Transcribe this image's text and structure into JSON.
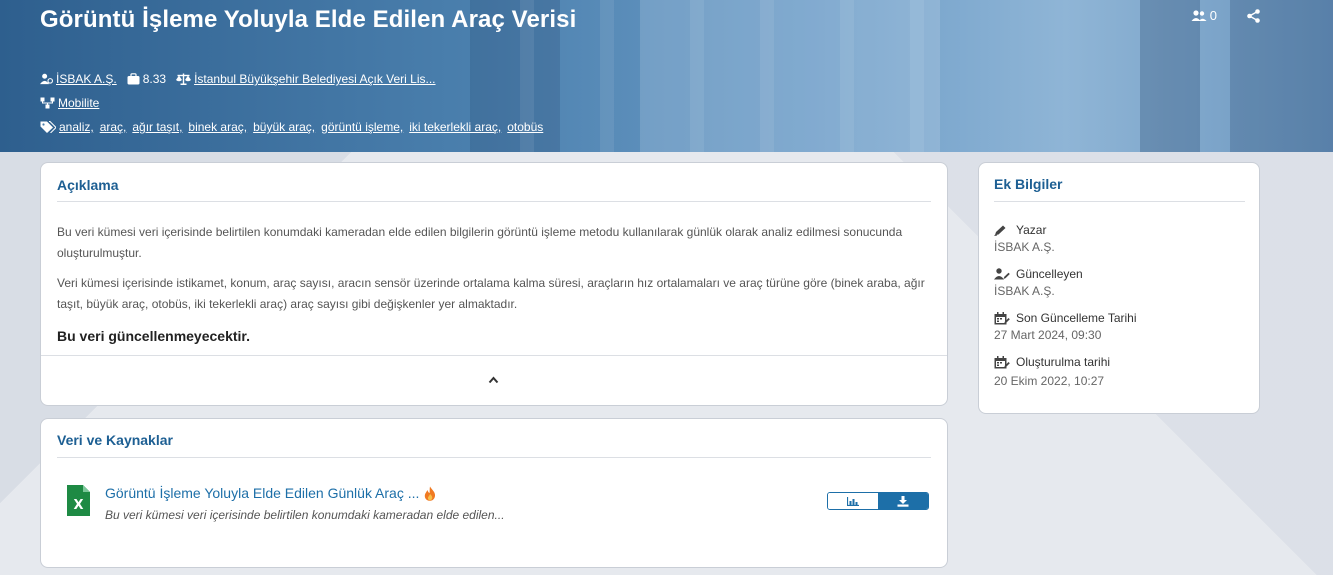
{
  "hero": {
    "title": "Görüntü İşleme Yoluyla Elde Edilen Araç Verisi",
    "publisher": "İSBAK A.Ş.",
    "rating": "8.33",
    "license": "İstanbul Büyükşehir Belediyesi Açık Veri Lis...",
    "category": "Mobilite",
    "tags": [
      "analiz,",
      "araç,",
      "ağır taşıt,",
      "binek araç,",
      "büyük araç,",
      "görüntü işleme,",
      "iki tekerlekli araç,",
      "otobüs"
    ],
    "followers": "0"
  },
  "description": {
    "title": "Açıklama",
    "paragraph1": "Bu veri kümesi veri içerisinde belirtilen konumdaki kameradan elde edilen bilgilerin görüntü işleme metodu kullanılarak günlük olarak analiz edilmesi sonucunda oluşturulmuştur.",
    "paragraph2": "Veri kümesi içerisinde istikamet, konum, araç sayısı, aracın sensör üzerinde ortalama kalma süresi, araçların hız ortalamaları ve araç türüne göre (binek araba, ağır taşıt, büyük araç, otobüs, iki tekerlekli araç) araç sayısı gibi değişkenler yer almaktadır.",
    "note": "Bu veri güncellenmeyecektir."
  },
  "resources": {
    "title": "Veri ve Kaynaklar",
    "item_title": "Görüntü İşleme Yoluyla Elde Edilen Günlük Araç ...",
    "item_subtitle": "Bu veri kümesi veri içerisinde belirtilen konumdaki kameradan elde edilen..."
  },
  "extra_info": {
    "title": "Ek Bilgiler",
    "author_label": "Yazar",
    "author_value": "İSBAK A.Ş.",
    "updater_label": "Güncelleyen",
    "updater_value": "İSBAK A.Ş.",
    "last_update_label": "Son Güncelleme Tarihi",
    "last_update_value": "27 Mart 2024, 09:30",
    "created_label": "Oluşturulma tarihi",
    "created_value": "20 Ekim 2022, 10:27"
  },
  "colors": {
    "accent": "#1d5f93",
    "link": "#1d6fa8",
    "excel_green": "#1e8a44",
    "fire": "#f07a22"
  },
  "icons": [
    "user-icon",
    "briefcase-icon",
    "scale-icon",
    "category-icon",
    "tag-icon",
    "users-icon",
    "share-icon",
    "chevron-up-icon",
    "excel-file-icon",
    "fire-icon",
    "chart-icon",
    "download-icon",
    "pen-icon",
    "user-edit-icon",
    "calendar-icon"
  ]
}
